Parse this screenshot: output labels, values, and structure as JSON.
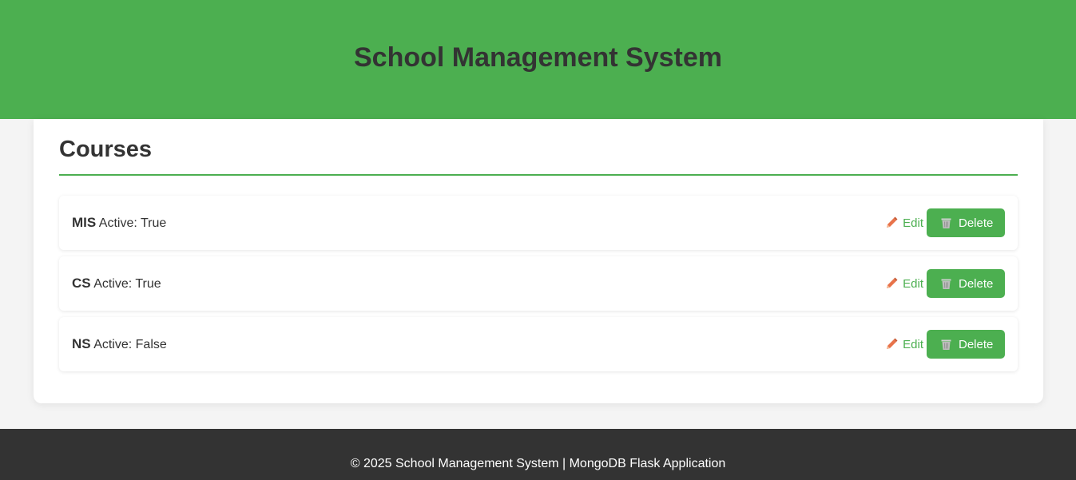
{
  "header": {
    "title": "School Management System"
  },
  "courses_section": {
    "title": "Courses",
    "items": [
      {
        "name": "MIS",
        "status": "Active: True",
        "edit_label": "Edit",
        "delete_label": "Delete"
      },
      {
        "name": "CS",
        "status": "Active: True",
        "edit_label": "Edit",
        "delete_label": "Delete"
      },
      {
        "name": "NS",
        "status": "Active: False",
        "edit_label": "Edit",
        "delete_label": "Delete"
      }
    ]
  },
  "footer": {
    "text": "© 2025 School Management System | MongoDB Flask Application"
  },
  "icons": {
    "edit": "pencil-icon",
    "delete": "wastebasket-icon"
  },
  "colors": {
    "accent": "#4caf50",
    "pencil": "#e8734a",
    "footer_bg": "#333333",
    "text": "#333333"
  }
}
